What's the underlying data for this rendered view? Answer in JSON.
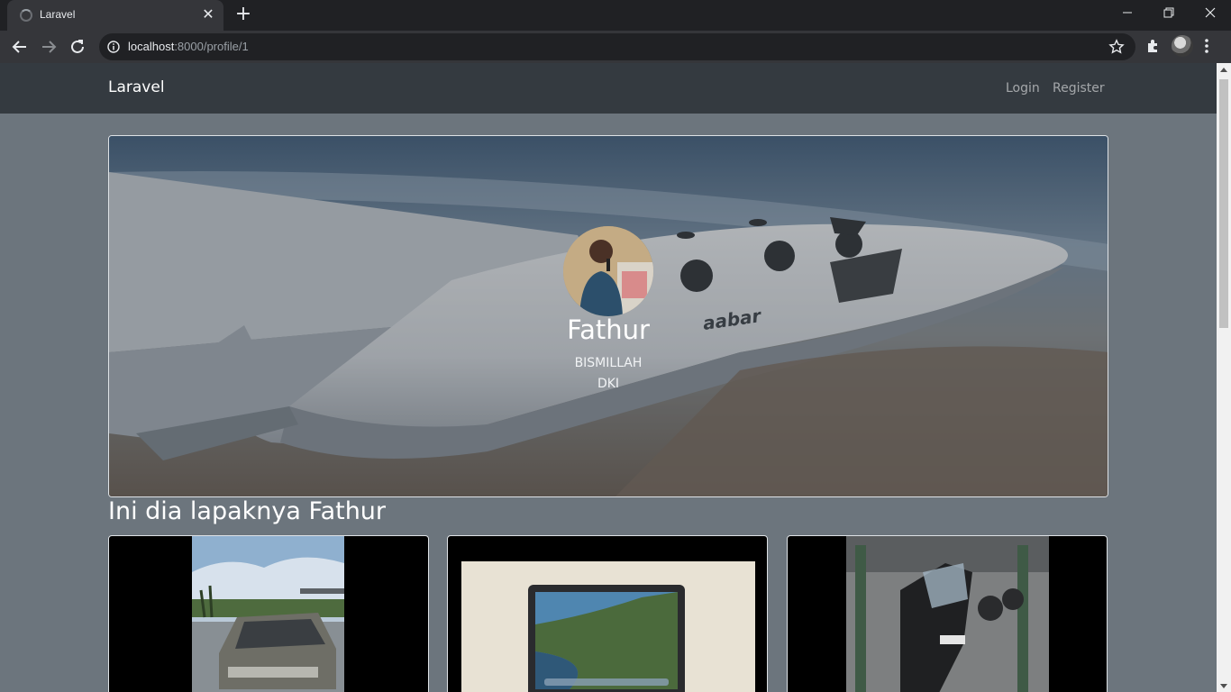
{
  "browser": {
    "tab_title": "Laravel",
    "url_host": "localhost",
    "url_rest": ":8000/profile/1"
  },
  "navbar": {
    "brand": "Laravel",
    "login": "Login",
    "register": "Register"
  },
  "profile": {
    "name": "Fathur",
    "bio": "BISMILLAH",
    "city": "DKI"
  },
  "lapak": {
    "title": "Ini dia lapaknya Fathur",
    "items": [
      {
        "image": "car-photo"
      },
      {
        "image": "laptop-photo"
      },
      {
        "image": "motorcycle-photo"
      }
    ]
  },
  "colors": {
    "navbar_bg": "#343a40",
    "page_bg": "#6c757d"
  }
}
